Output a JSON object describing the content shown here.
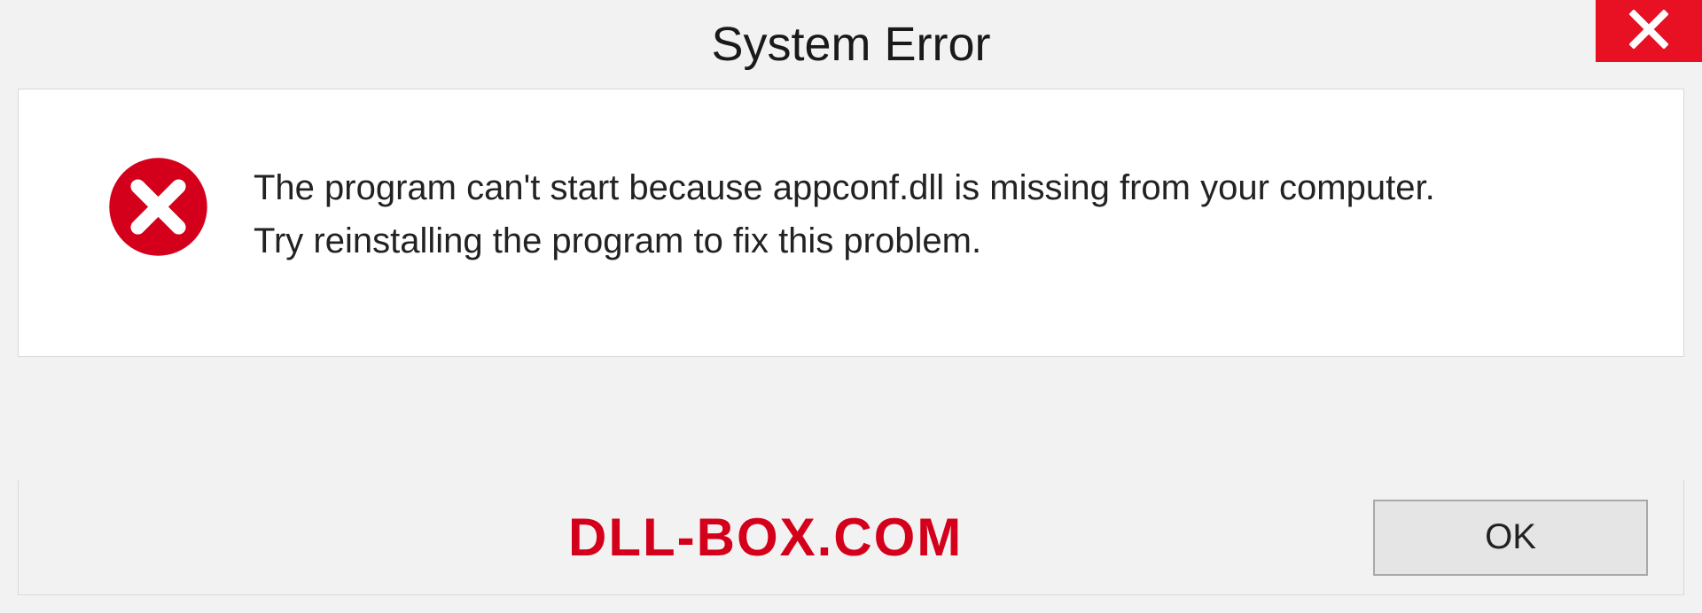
{
  "dialog": {
    "title": "System Error",
    "message_line1": "The program can't start because appconf.dll is missing from your computer.",
    "message_line2": "Try reinstalling the program to fix this problem.",
    "ok_label": "OK"
  },
  "watermark": "DLL-BOX.COM",
  "colors": {
    "close_bg": "#e81123",
    "error_icon": "#d4001b",
    "watermark": "#d4001b"
  }
}
